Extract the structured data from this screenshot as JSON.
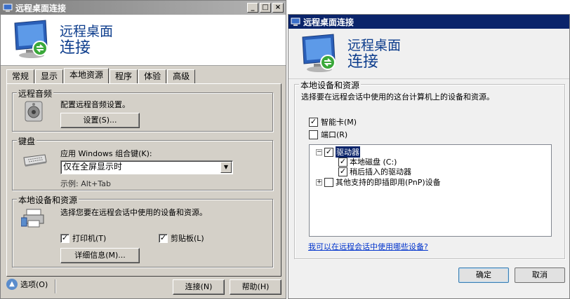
{
  "win1": {
    "title": "远程桌面连接",
    "banner": {
      "line1": "远程桌面",
      "line2": "连接"
    },
    "tabs": [
      "常规",
      "显示",
      "本地资源",
      "程序",
      "体验",
      "高级"
    ],
    "audio": {
      "group_label": "远程音频",
      "desc": "配置远程音频设置。",
      "settings_button": "设置(S)..."
    },
    "keyboard": {
      "group_label": "键盘",
      "apply_label": "应用 Windows 组合键(K):",
      "selected": "仅在全屏显示时",
      "example": "示例: Alt+Tab"
    },
    "local": {
      "group_label": "本地设备和资源",
      "desc": "选择您要在远程会话中使用的设备和资源。",
      "printer": "打印机(T)",
      "clipboard": "剪贴板(L)",
      "details_button": "详细信息(M)..."
    },
    "footer": {
      "options": "选项(O)",
      "connect": "连接(N)",
      "help": "帮助(H)"
    }
  },
  "win2": {
    "title": "远程桌面连接",
    "banner": {
      "line1": "远程桌面",
      "line2": "连接"
    },
    "group_label": "本地设备和资源",
    "desc": "选择要在远程会话中使用的这台计算机上的设备和资源。",
    "smartcard": "智能卡(M)",
    "ports": "端口(R)",
    "tree": {
      "drives": "驱动器",
      "local_disk": "本地磁盘 (C:)",
      "later_drives": "稍后插入的驱动器",
      "pnp": "其他支持的即插即用(PnP)设备"
    },
    "help_link": "我可以在远程会话中使用哪些设备?",
    "ok": "确定",
    "cancel": "取消"
  }
}
